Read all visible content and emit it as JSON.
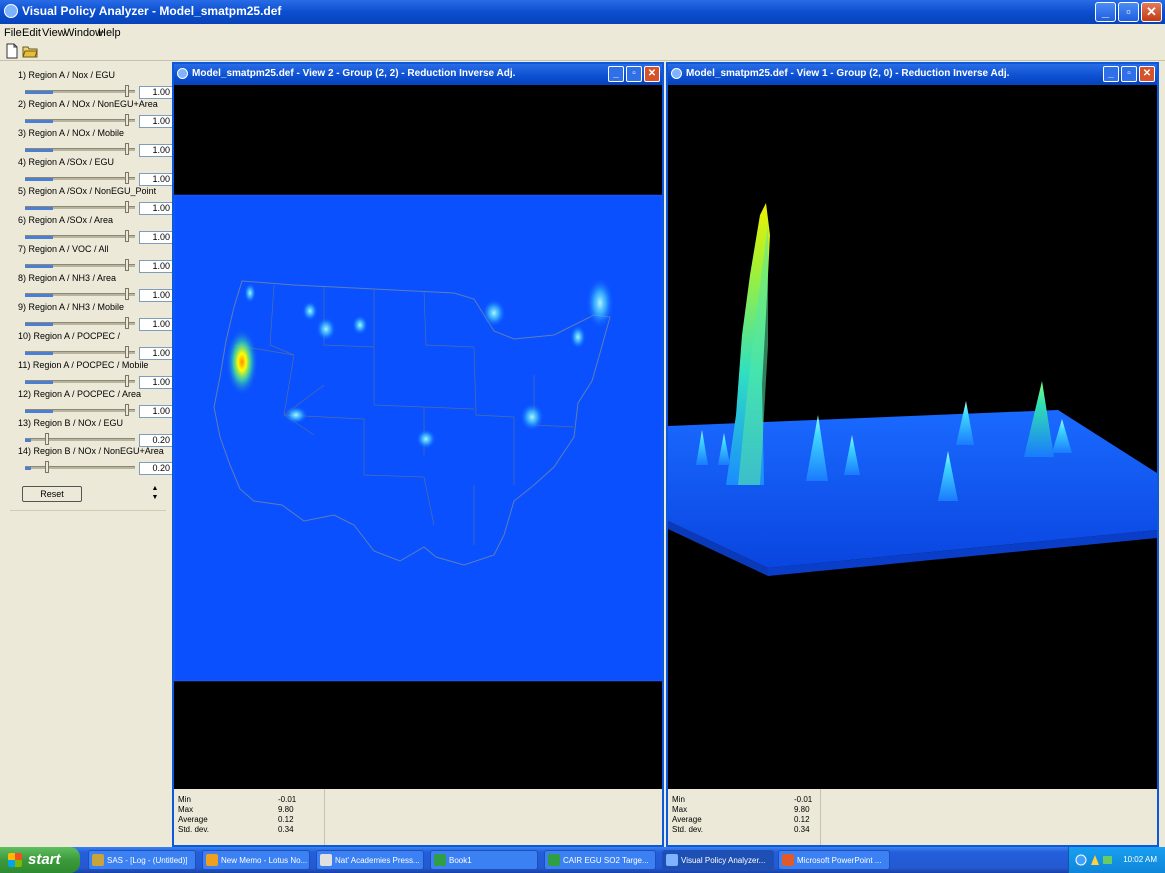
{
  "app": {
    "title": "Visual Policy Analyzer - Model_smatpm25.def",
    "controls": {
      "minimize": "_",
      "restore": "▫",
      "close": "✕"
    }
  },
  "menu": [
    "File",
    "Edit",
    "View",
    "Window",
    "Help"
  ],
  "toolbar": {
    "icons": [
      "new-document-icon",
      "open-folder-icon"
    ]
  },
  "params": [
    {
      "label": "1) Region A / Nox / EGU",
      "value": "1.00",
      "level": 1.0
    },
    {
      "label": "2) Region A / NOx / NonEGU+Area",
      "value": "1.00",
      "level": 1.0
    },
    {
      "label": "3) Region A / NOx / Mobile",
      "value": "1.00",
      "level": 1.0
    },
    {
      "label": "4) Region A /SOx / EGU",
      "value": "1.00",
      "level": 1.0
    },
    {
      "label": "5) Region A /SOx / NonEGU_Point",
      "value": "1.00",
      "level": 1.0
    },
    {
      "label": "6) Region A /SOx / Area",
      "value": "1.00",
      "level": 1.0
    },
    {
      "label": "7) Region A / VOC / All",
      "value": "1.00",
      "level": 1.0
    },
    {
      "label": "8) Region A / NH3 / Area",
      "value": "1.00",
      "level": 1.0
    },
    {
      "label": "9) Region A / NH3 / Mobile",
      "value": "1.00",
      "level": 1.0
    },
    {
      "label": "10) Region A / POCPEC /",
      "value": "1.00",
      "level": 1.0
    },
    {
      "label": "11) Region A / POCPEC / Mobile",
      "value": "1.00",
      "level": 1.0
    },
    {
      "label": "12) Region A / POCPEC / Area",
      "value": "1.00",
      "level": 1.0
    },
    {
      "label": "13) Region B / NOx / EGU",
      "value": "0.20",
      "level": 0.2
    },
    {
      "label": "14) Region B / NOx / NonEGU+Area",
      "value": "0.20",
      "level": 0.2
    }
  ],
  "reset_label": "Reset",
  "view2": {
    "title": "Model_smatpm25.def - View 2 - Group (2, 2) - Reduction Inverse Adj.",
    "stats": [
      {
        "key": "Min",
        "value": "-0.01"
      },
      {
        "key": "Max",
        "value": "9.80"
      },
      {
        "key": "Average",
        "value": "0.12"
      },
      {
        "key": "Std. dev.",
        "value": "0.34"
      }
    ]
  },
  "view1": {
    "title": "Model_smatpm25.def - View 1 - Group (2, 0) - Reduction Inverse Adj.",
    "stats": [
      {
        "key": "Min",
        "value": "-0.01"
      },
      {
        "key": "Max",
        "value": "9.80"
      },
      {
        "key": "Average",
        "value": "0.12"
      },
      {
        "key": "Std. dev.",
        "value": "0.34"
      }
    ]
  },
  "taskbar": {
    "start": "start",
    "tasks": [
      {
        "label": "SAS - [Log - (Untitled)]",
        "color": "#c9a33c",
        "active": false
      },
      {
        "label": "New Memo - Lotus No...",
        "color": "#f0a020",
        "active": false
      },
      {
        "label": "Nat' Academies Press...",
        "color": "#e0e0e0",
        "active": false
      },
      {
        "label": "Book1",
        "color": "#2f9e44",
        "active": false
      },
      {
        "label": "CAIR EGU SO2 Targe...",
        "color": "#2f9e44",
        "active": false
      },
      {
        "label": "Visual Policy Analyzer...",
        "color": "#7fb2ff",
        "active": true
      },
      {
        "label": "Microsoft PowerPoint ...",
        "color": "#e05a2a",
        "active": false
      }
    ],
    "clock": "10:02 AM"
  },
  "colors": {
    "titlebar": "#0a4fd0",
    "viewport_bg": "#000000",
    "map_blue": "#0a50ff",
    "hotspot": "#ffff00"
  }
}
